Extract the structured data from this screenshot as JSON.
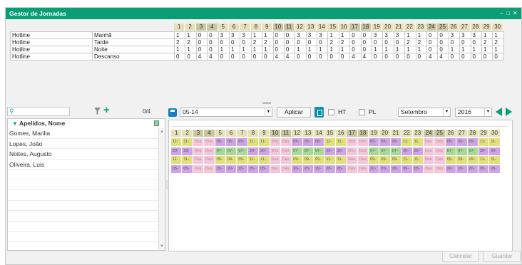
{
  "window": {
    "title": "Gestor de Jornadas",
    "controls": [
      "–",
      "□",
      "✕"
    ]
  },
  "days": [
    "1",
    "2",
    "3",
    "4",
    "5",
    "6",
    "7",
    "8",
    "9",
    "10",
    "11",
    "12",
    "13",
    "14",
    "15",
    "16",
    "17",
    "18",
    "19",
    "20",
    "21",
    "22",
    "23",
    "24",
    "25",
    "26",
    "27",
    "28",
    "29",
    "30"
  ],
  "summary": [
    {
      "team": "Hotline",
      "shift": "Manhã",
      "values": [
        "1",
        "1",
        "0",
        "0",
        "3",
        "3",
        "3",
        "1",
        "1",
        "0",
        "0",
        "3",
        "3",
        "3",
        "1",
        "1",
        "0",
        "0",
        "3",
        "3",
        "3",
        "1",
        "1",
        "0",
        "0",
        "3",
        "3",
        "3",
        "1",
        "1"
      ]
    },
    {
      "team": "Hotline",
      "shift": "Tarde",
      "values": [
        "2",
        "2",
        "0",
        "0",
        "0",
        "0",
        "0",
        "2",
        "2",
        "0",
        "0",
        "0",
        "0",
        "0",
        "2",
        "2",
        "0",
        "0",
        "0",
        "0",
        "0",
        "2",
        "2",
        "0",
        "0",
        "0",
        "0",
        "0",
        "2",
        "2"
      ]
    },
    {
      "team": "Hotline",
      "shift": "Noite",
      "values": [
        "1",
        "1",
        "0",
        "0",
        "1",
        "1",
        "1",
        "1",
        "1",
        "0",
        "0",
        "1",
        "1",
        "1",
        "1",
        "1",
        "0",
        "0",
        "1",
        "1",
        "1",
        "1",
        "1",
        "0",
        "0",
        "1",
        "1",
        "1",
        "1",
        "1"
      ]
    },
    {
      "team": "Hotline",
      "shift": "Descanso",
      "values": [
        "0",
        "0",
        "4",
        "4",
        "0",
        "0",
        "0",
        "0",
        "0",
        "4",
        "4",
        "0",
        "0",
        "0",
        "0",
        "0",
        "4",
        "4",
        "0",
        "0",
        "0",
        "0",
        "0",
        "4",
        "4",
        "0",
        "0",
        "0",
        "0",
        "0"
      ]
    }
  ],
  "left": {
    "search_placeholder": "",
    "count": "0/4",
    "header": "Apelidos, Nome",
    "names": [
      "Gomes, Marilia",
      "Lopes, João",
      "Noites, Augusto",
      "Oliveira, Luis"
    ],
    "icons": {
      "search": "search-icon",
      "filter": "filter-icon",
      "add": "plus-icon",
      "columns": "columns-icon"
    }
  },
  "toolbar": {
    "week_selector": "05-14",
    "apply_label": "Aplicar",
    "ht_label": "HT",
    "pl_label": "PL",
    "month": "Setembro",
    "year": "2016",
    "icons": {
      "print": "print-icon",
      "delete": "trash-icon",
      "prev": "prev-arrow-icon",
      "next": "next-arrow-icon"
    }
  },
  "schedule": [
    [
      "11-",
      "11-",
      "Des",
      "Des",
      "05-",
      "05-",
      "05-",
      "11-",
      "11-",
      "Des",
      "Des",
      "05-",
      "05-",
      "05-",
      "11-",
      "11-",
      "Des",
      "Des",
      "05-",
      "05-",
      "05-",
      "11-",
      "11-",
      "Des",
      "Des",
      "05-",
      "05-",
      "05-",
      "11-",
      "11-"
    ],
    [
      "20-",
      "20-",
      "Des",
      "Des",
      "07-",
      "07-",
      "07-",
      "20-",
      "20-",
      "Des",
      "Des",
      "07-",
      "07-",
      "07-",
      "20-",
      "20-",
      "Des",
      "Des",
      "07-",
      "07-",
      "07-",
      "20-",
      "20-",
      "Des",
      "Des",
      "07-",
      "07-",
      "07-",
      "20-",
      "20-"
    ],
    [
      "11-",
      "11-",
      "Des",
      "Des",
      "09-",
      "09-",
      "09-",
      "11-",
      "11-",
      "Des",
      "Des",
      "09-",
      "09-",
      "09-",
      "11-",
      "11-",
      "Des",
      "Des",
      "09-",
      "09-",
      "09-",
      "11-",
      "11-",
      "Des",
      "Des",
      "09-",
      "09-",
      "09-",
      "11-",
      "11-"
    ],
    [
      "05-",
      "05-",
      "Des",
      "Des",
      "20-",
      "20-",
      "20-",
      "05-",
      "05-",
      "Des",
      "Des",
      "20-",
      "20-",
      "20-",
      "05-",
      "05-",
      "Des",
      "Des",
      "20-",
      "20-",
      "20-",
      "05-",
      "05-",
      "Des",
      "Des",
      "20-",
      "20-",
      "20-",
      "05-",
      "05-"
    ]
  ],
  "weekend_days": [
    3,
    4,
    10,
    11,
    17,
    18,
    24,
    25
  ],
  "colors": {
    "titlebar": "#0b9e76",
    "day_header": "#e7e1b9",
    "day_header_weekend": "#c9c6a0",
    "shift_05": "#cfa3e5",
    "shift_07": "#a9d89a",
    "shift_09": "#e1e07d",
    "shift_11": "#e1e07d",
    "shift_20": "#cfa3e5",
    "rest": "#f3c9d9"
  },
  "footer": {
    "cancel_label": "Cancelar",
    "save_label": "Guardar"
  }
}
